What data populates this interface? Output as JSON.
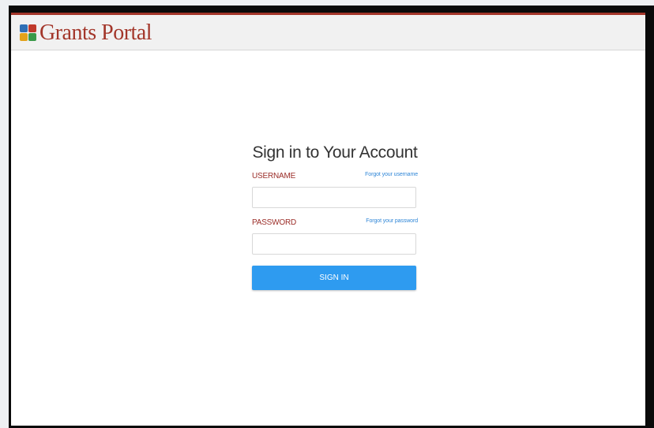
{
  "header": {
    "logo_text": "Grants Portal",
    "logo_icon": "grants-portal-logo-icon",
    "accent_color": "#a3362a"
  },
  "login": {
    "title": "Sign in to Your Account",
    "username_label": "USERNAME",
    "forgot_username": "Forgot your username",
    "username_value": "",
    "password_label": "PASSWORD",
    "forgot_password": "Forgot your password",
    "password_value": "",
    "signin_label": "SIGN IN",
    "button_color": "#2e9bf0"
  }
}
